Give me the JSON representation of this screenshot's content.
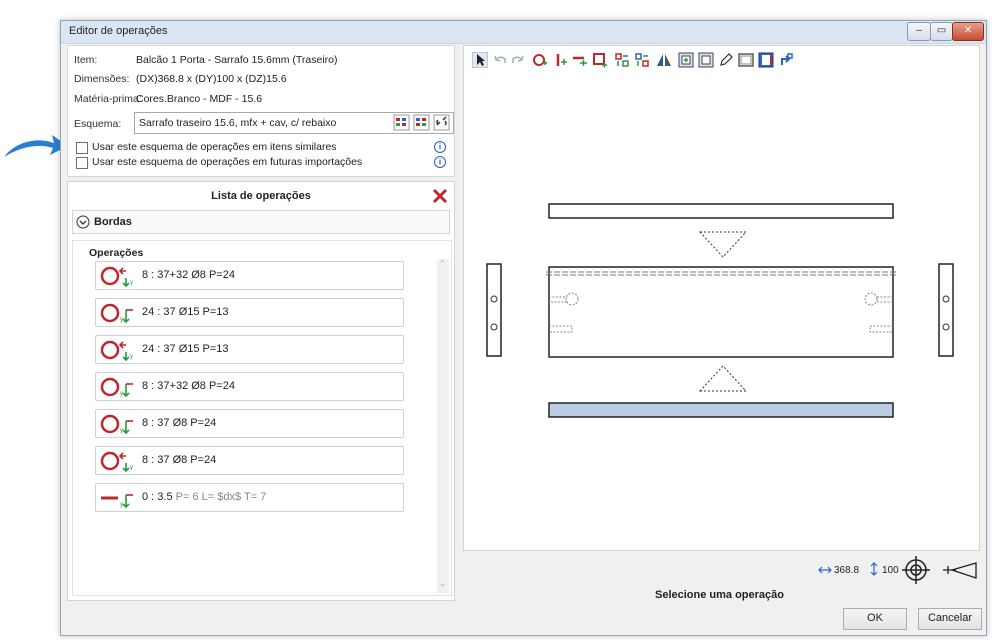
{
  "window": {
    "title": "Editor de operações",
    "controls": [
      "minimize-icon",
      "maximize-icon",
      "close-icon"
    ]
  },
  "info": {
    "item_label": "Item:",
    "item_value": "Balcão 1 Porta - Sarrafo 15.6mm (Traseiro)",
    "dim_label": "Dimensões:",
    "dim_value": "(DX)368.8 x (DY)100 x (DZ)15.6",
    "mat_label": "Matéria-prima:",
    "mat_value": "Cores.Branco - MDF - 15.6",
    "schema_label": "Esquema:",
    "schema_value": "Sarrafo traseiro 15.6, mfx + cav, c/ rebaixo",
    "check1_label": "Usar este esquema de operações em itens similares",
    "check2_label": "Usar este esquema de operações em futuras importações"
  },
  "operations_list": {
    "title": "Lista de operações",
    "bordas_label": "Bordas",
    "group_label": "Operações",
    "items": [
      {
        "icon": "drill-circle-icon",
        "text": "8 : 37+32 Ø8 P=24"
      },
      {
        "icon": "drill-circle-icon",
        "text": "24 : 37 Ø15 P=13"
      },
      {
        "icon": "drill-circle-icon",
        "text": "24 : 37 Ø15 P=13"
      },
      {
        "icon": "drill-circle-icon",
        "text": "8 : 37+32 Ø8 P=24"
      },
      {
        "icon": "drill-circle-icon",
        "text": "8 : 37 Ø8 P=24"
      },
      {
        "icon": "drill-circle-icon",
        "text": "8 : 37 Ø8 P=24"
      },
      {
        "icon": "groove-line-icon",
        "text_main": "0 : 3.5",
        "text_p": " P= 6",
        "text_l": " L= $dx$",
        "text_t": " T= 7"
      }
    ]
  },
  "status": {
    "dx_value": "368.8",
    "dy_value": "100",
    "select_prompt": "Selecione uma operação"
  },
  "buttons": {
    "ok": "OK",
    "cancel": "Cancelar"
  },
  "colors": {
    "accent_red": "#c0272d",
    "panel_fill": "#bccde6",
    "toolbar_blue": "#2b63c6",
    "arrow_blue": "#2a7fd4"
  }
}
